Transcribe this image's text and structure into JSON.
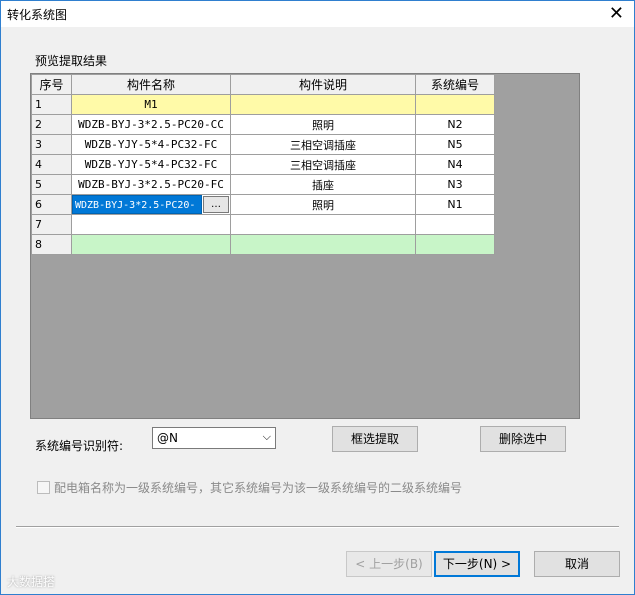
{
  "window": {
    "title": "转化系统图",
    "close_glyph": "✕"
  },
  "section_label": "预览提取结果",
  "grid": {
    "headers": [
      "序号",
      "构件名称",
      "构件说明",
      "系统编号"
    ],
    "rows": [
      {
        "idx": "1",
        "name": "M1",
        "desc": "",
        "code": ""
      },
      {
        "idx": "2",
        "name": "WDZB-BYJ-3*2.5-PC20-CC",
        "desc": "照明",
        "code": "N2"
      },
      {
        "idx": "3",
        "name": "WDZB-YJY-5*4-PC32-FC",
        "desc": "三相空调插座",
        "code": "N5"
      },
      {
        "idx": "4",
        "name": "WDZB-YJY-5*4-PC32-FC",
        "desc": "三相空调插座",
        "code": "N4"
      },
      {
        "idx": "5",
        "name": "WDZB-BYJ-3*2.5-PC20-FC",
        "desc": "插座",
        "code": "N3"
      },
      {
        "idx": "6",
        "name": "WDZB-BYJ-3*2.5-PC20-",
        "desc": "照明",
        "code": "N1"
      },
      {
        "idx": "7",
        "name": "",
        "desc": "",
        "code": ""
      },
      {
        "idx": "8",
        "name": "",
        "desc": "",
        "code": ""
      }
    ],
    "ellipsis": "…"
  },
  "identifier": {
    "label": "系统编号识别符:",
    "value": "@N",
    "arrow": "⌵"
  },
  "buttons": {
    "frame_extract": "框选提取",
    "delete_selected": "删除选中",
    "prev": "< 上一步(B)",
    "next": "下一步(N) >",
    "cancel": "取消"
  },
  "checkbox_label": "配电箱名称为一级系统编号，其它系统编号为该一级系统编号的二级系统编号",
  "watermark": "大数据搭"
}
